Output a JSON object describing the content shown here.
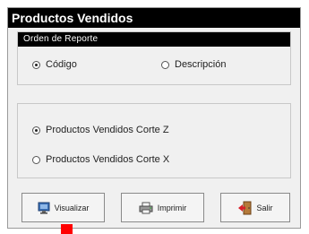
{
  "window": {
    "title": "Productos Vendidos"
  },
  "orden": {
    "header": "Orden de Reporte",
    "options": [
      {
        "label": "Código",
        "checked": true
      },
      {
        "label": "Descripción",
        "checked": false
      }
    ]
  },
  "reportes": {
    "options": [
      {
        "label": "Productos Vendidos Corte Z",
        "checked": true
      },
      {
        "label": "Productos Vendidos Corte X",
        "checked": false
      }
    ]
  },
  "buttons": {
    "preview_label": "Visualizar",
    "print_label": "Imprimir",
    "exit_label": "Salir"
  },
  "icons": {
    "preview": "monitor-icon",
    "print": "printer-icon",
    "exit": "exit-door-icon"
  },
  "colors": {
    "titlebar": "#000000",
    "marker": "#ff0000"
  }
}
